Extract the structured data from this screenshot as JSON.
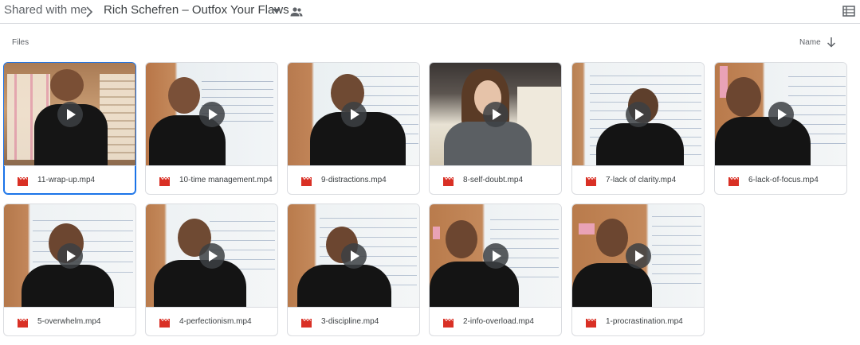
{
  "breadcrumb": {
    "root": "Shared with me",
    "current": "Rich Schefren – Outfox Your Flaws"
  },
  "section": {
    "files_label": "Files",
    "sort_label": "Name"
  },
  "icons": {
    "breadcrumb_separator": "chevron-right-icon",
    "dropdown": "caret-down-icon",
    "shared": "people-icon",
    "view_toggle": "list-view-icon",
    "sort": "arrow-down-icon",
    "file_type": "video-file-icon",
    "play": "play-icon"
  },
  "colors": {
    "accent": "#1a73e8",
    "video_icon": "#d93025",
    "border": "#dadce0"
  },
  "files": [
    {
      "name": "11-wrap-up.mp4",
      "selected": true
    },
    {
      "name": "10-time management.mp4",
      "selected": false
    },
    {
      "name": "9-distractions.mp4",
      "selected": false
    },
    {
      "name": "8-self-doubt.mp4",
      "selected": false
    },
    {
      "name": "7-lack of clarity.mp4",
      "selected": false
    },
    {
      "name": "6-lack-of-focus.mp4",
      "selected": false
    },
    {
      "name": "5-overwhelm.mp4",
      "selected": false
    },
    {
      "name": "4-perfectionism.mp4",
      "selected": false
    },
    {
      "name": "3-discipline.mp4",
      "selected": false
    },
    {
      "name": "2-info-overload.mp4",
      "selected": false
    },
    {
      "name": "1-procrastination.mp4",
      "selected": false
    }
  ]
}
